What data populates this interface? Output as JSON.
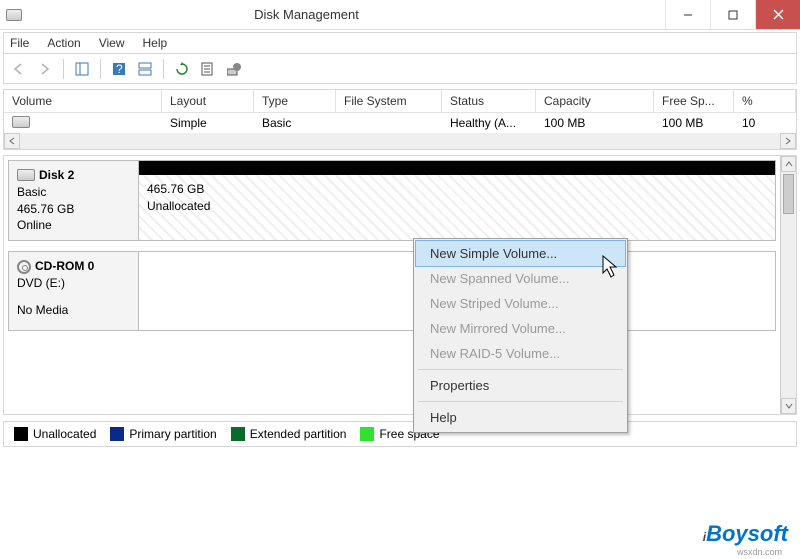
{
  "title": "Disk Management",
  "menus": {
    "file": "File",
    "action": "Action",
    "view": "View",
    "help": "Help"
  },
  "columns": {
    "volume": "Volume",
    "layout": "Layout",
    "type": "Type",
    "filesystem": "File System",
    "status": "Status",
    "capacity": "Capacity",
    "freespace": "Free Sp...",
    "pct": "%"
  },
  "row1": {
    "volume": "",
    "layout": "Simple",
    "type": "Basic",
    "fs": "",
    "status": "Healthy (A...",
    "capacity": "100 MB",
    "free": "100 MB",
    "pct": "10"
  },
  "disk2": {
    "name": "Disk 2",
    "type": "Basic",
    "size": "465.76 GB",
    "state": "Online",
    "part_size": "465.76 GB",
    "part_label": "Unallocated"
  },
  "cdrom": {
    "name": "CD-ROM 0",
    "label": "DVD (E:)",
    "state": "No Media"
  },
  "legend": {
    "unallocated": "Unallocated",
    "primary": "Primary partition",
    "extended": "Extended partition",
    "free": "Free space"
  },
  "ctx": {
    "simple": "New Simple Volume...",
    "spanned": "New Spanned Volume...",
    "striped": "New Striped Volume...",
    "mirrored": "New Mirrored Volume...",
    "raid5": "New RAID-5 Volume...",
    "props": "Properties",
    "help": "Help"
  },
  "watermark": "iBoysoft",
  "wm_url": "wsxdn.com"
}
